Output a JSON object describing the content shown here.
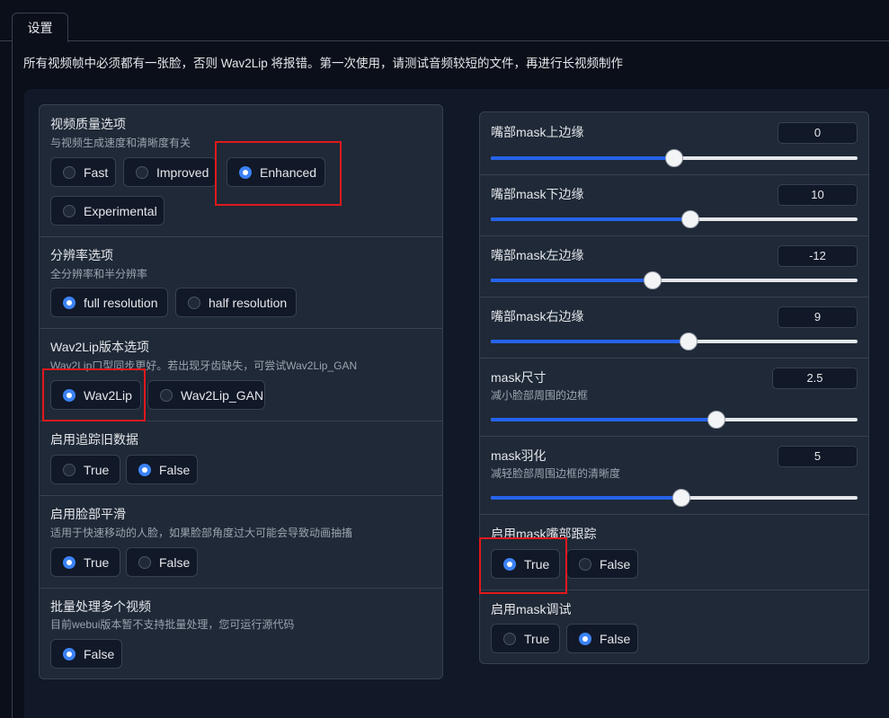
{
  "tab": {
    "label": "设置"
  },
  "notice": "所有视频帧中必须都有一张脸，否则 Wav2Lip 将报错。第一次使用，请测试音频较短的文件，再进行长视频制作",
  "left": {
    "quality": {
      "title": "视频质量选项",
      "info": "与视频生成速度和清晰度有关",
      "options": [
        "Fast",
        "Improved",
        "Enhanced",
        "Experimental"
      ],
      "selected": "Enhanced"
    },
    "resolution": {
      "title": "分辨率选项",
      "info": "全分辨率和半分辨率",
      "options": [
        "full resolution",
        "half resolution"
      ],
      "selected": "full resolution"
    },
    "version": {
      "title": "Wav2Lip版本选项",
      "info": "Wav2Lip口型同步更好。若出现牙齿缺失，可尝试Wav2Lip_GAN",
      "options": [
        "Wav2Lip",
        "Wav2Lip_GAN"
      ],
      "selected": "Wav2Lip"
    },
    "tracking": {
      "title": "启用追踪旧数据",
      "options": [
        "True",
        "False"
      ],
      "selected": "False"
    },
    "smoothing": {
      "title": "启用脸部平滑",
      "info": "适用于快速移动的人脸，如果脸部角度过大可能会导致动画抽搐",
      "options": [
        "True",
        "False"
      ],
      "selected": "True"
    },
    "batch": {
      "title": "批量处理多个视频",
      "info": "目前webui版本暂不支持批量处理，您可运行源代码",
      "options": [
        "False"
      ],
      "selected": "False"
    }
  },
  "right": {
    "sliders": [
      {
        "label": "嘴部mask上边缘",
        "value": "0",
        "fraction": 0.5
      },
      {
        "label": "嘴部mask下边缘",
        "value": "10",
        "fraction": 0.545
      },
      {
        "label": "嘴部mask左边缘",
        "value": "-12",
        "fraction": 0.44
      },
      {
        "label": "嘴部mask右边缘",
        "value": "9",
        "fraction": 0.54
      },
      {
        "label": "mask尺寸",
        "info": "减小脸部周围的边框",
        "value": "2.5",
        "fraction": 0.615
      },
      {
        "label": "mask羽化",
        "info": "减轻脸部周围边框的清晰度",
        "value": "5",
        "fraction": 0.52
      }
    ],
    "mouth_tracking": {
      "title": "启用mask嘴部跟踪",
      "options": [
        "True",
        "False"
      ],
      "selected": "True"
    },
    "mask_debug": {
      "title": "启用mask调试",
      "options": [
        "True",
        "False"
      ],
      "selected": "False"
    }
  },
  "colors": {
    "accent": "#2563eb",
    "highlight": "#e0191c",
    "background": "#0b0f19"
  }
}
